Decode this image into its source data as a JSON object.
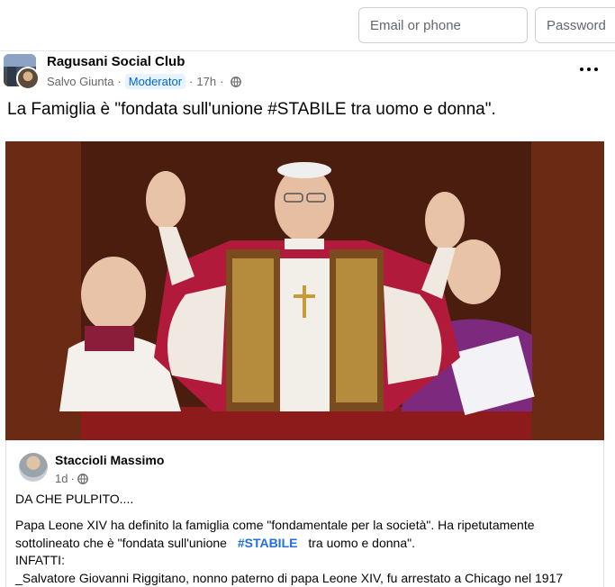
{
  "login": {
    "email_placeholder": "Email or phone",
    "password_placeholder": "Password"
  },
  "post": {
    "group_name": "Ragusani Social Club",
    "author": "Salvo Giunta",
    "role_badge": "Moderator",
    "time": "17h",
    "visibility_icon": "globe-icon",
    "text": "La Famiglia è \"fondata sull'unione #STABILE tra uomo e donna\"."
  },
  "shared": {
    "author": "Staccioli Massimo",
    "time": "1d",
    "line1": "DA CHE PULPITO....",
    "line2": "Papa Leone XIV  ha definito la famiglia come \"fondamentale per la società\". Ha ripetutamente",
    "line3_pre": "sottolineato che è \"fondata sull'unione ",
    "line3_hashtag": "#STABILE",
    "line3_post": " tra uomo e donna\".",
    "line4": "INFATTI:",
    "line5": "_Salvatore Giovanni Riggitano, nonno paterno di papa Leone XIV, fu arrestato a Chicago nel 1917"
  },
  "colors": {
    "accent": "#216fdb",
    "badge_bg": "#e7f3ff",
    "photo_bg": "#6b2a14"
  }
}
